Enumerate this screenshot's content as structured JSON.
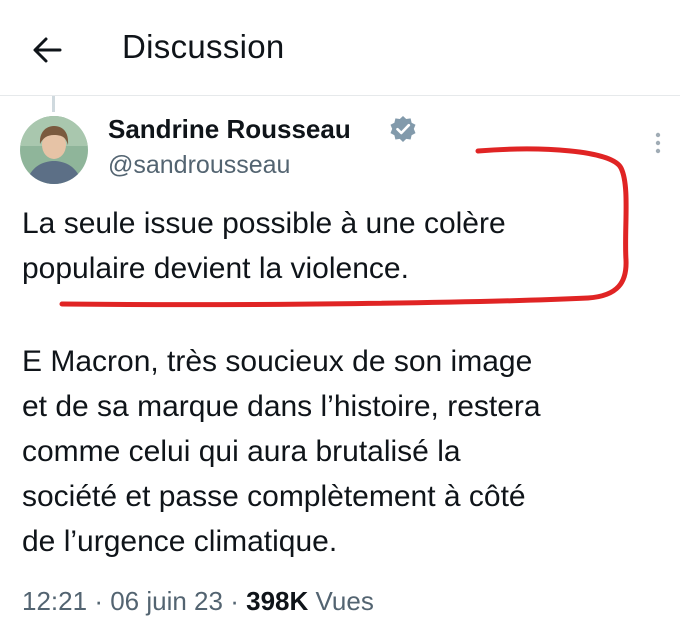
{
  "header": {
    "back_icon": "arrow-left-icon",
    "title": "Discussion"
  },
  "tweet": {
    "author": {
      "name": "Sandrine Rousseau",
      "handle": "@sandrousseau",
      "verified_icon": "verified-badge-icon",
      "verified_color": "#829aab"
    },
    "more_icon": "more-vertical-icon",
    "paragraphs": [
      {
        "lines": [
          "La seule issue possible à une colère",
          "populaire devient la violence."
        ]
      },
      {
        "lines": [
          "E Macron, très soucieux de son image",
          "et de sa marque dans l’histoire, restera",
          "comme celui qui aura brutalisé la",
          "société et passe complètement à côté",
          "de l’urgence climatique."
        ]
      }
    ],
    "meta": {
      "time": "12:21",
      "separator": "·",
      "date": "06 juin 23",
      "views_count": "398K",
      "views_label": "Vues"
    }
  },
  "colors": {
    "text": "#0f1419",
    "secondary": "#536471",
    "annotation_red": "#e02424"
  }
}
